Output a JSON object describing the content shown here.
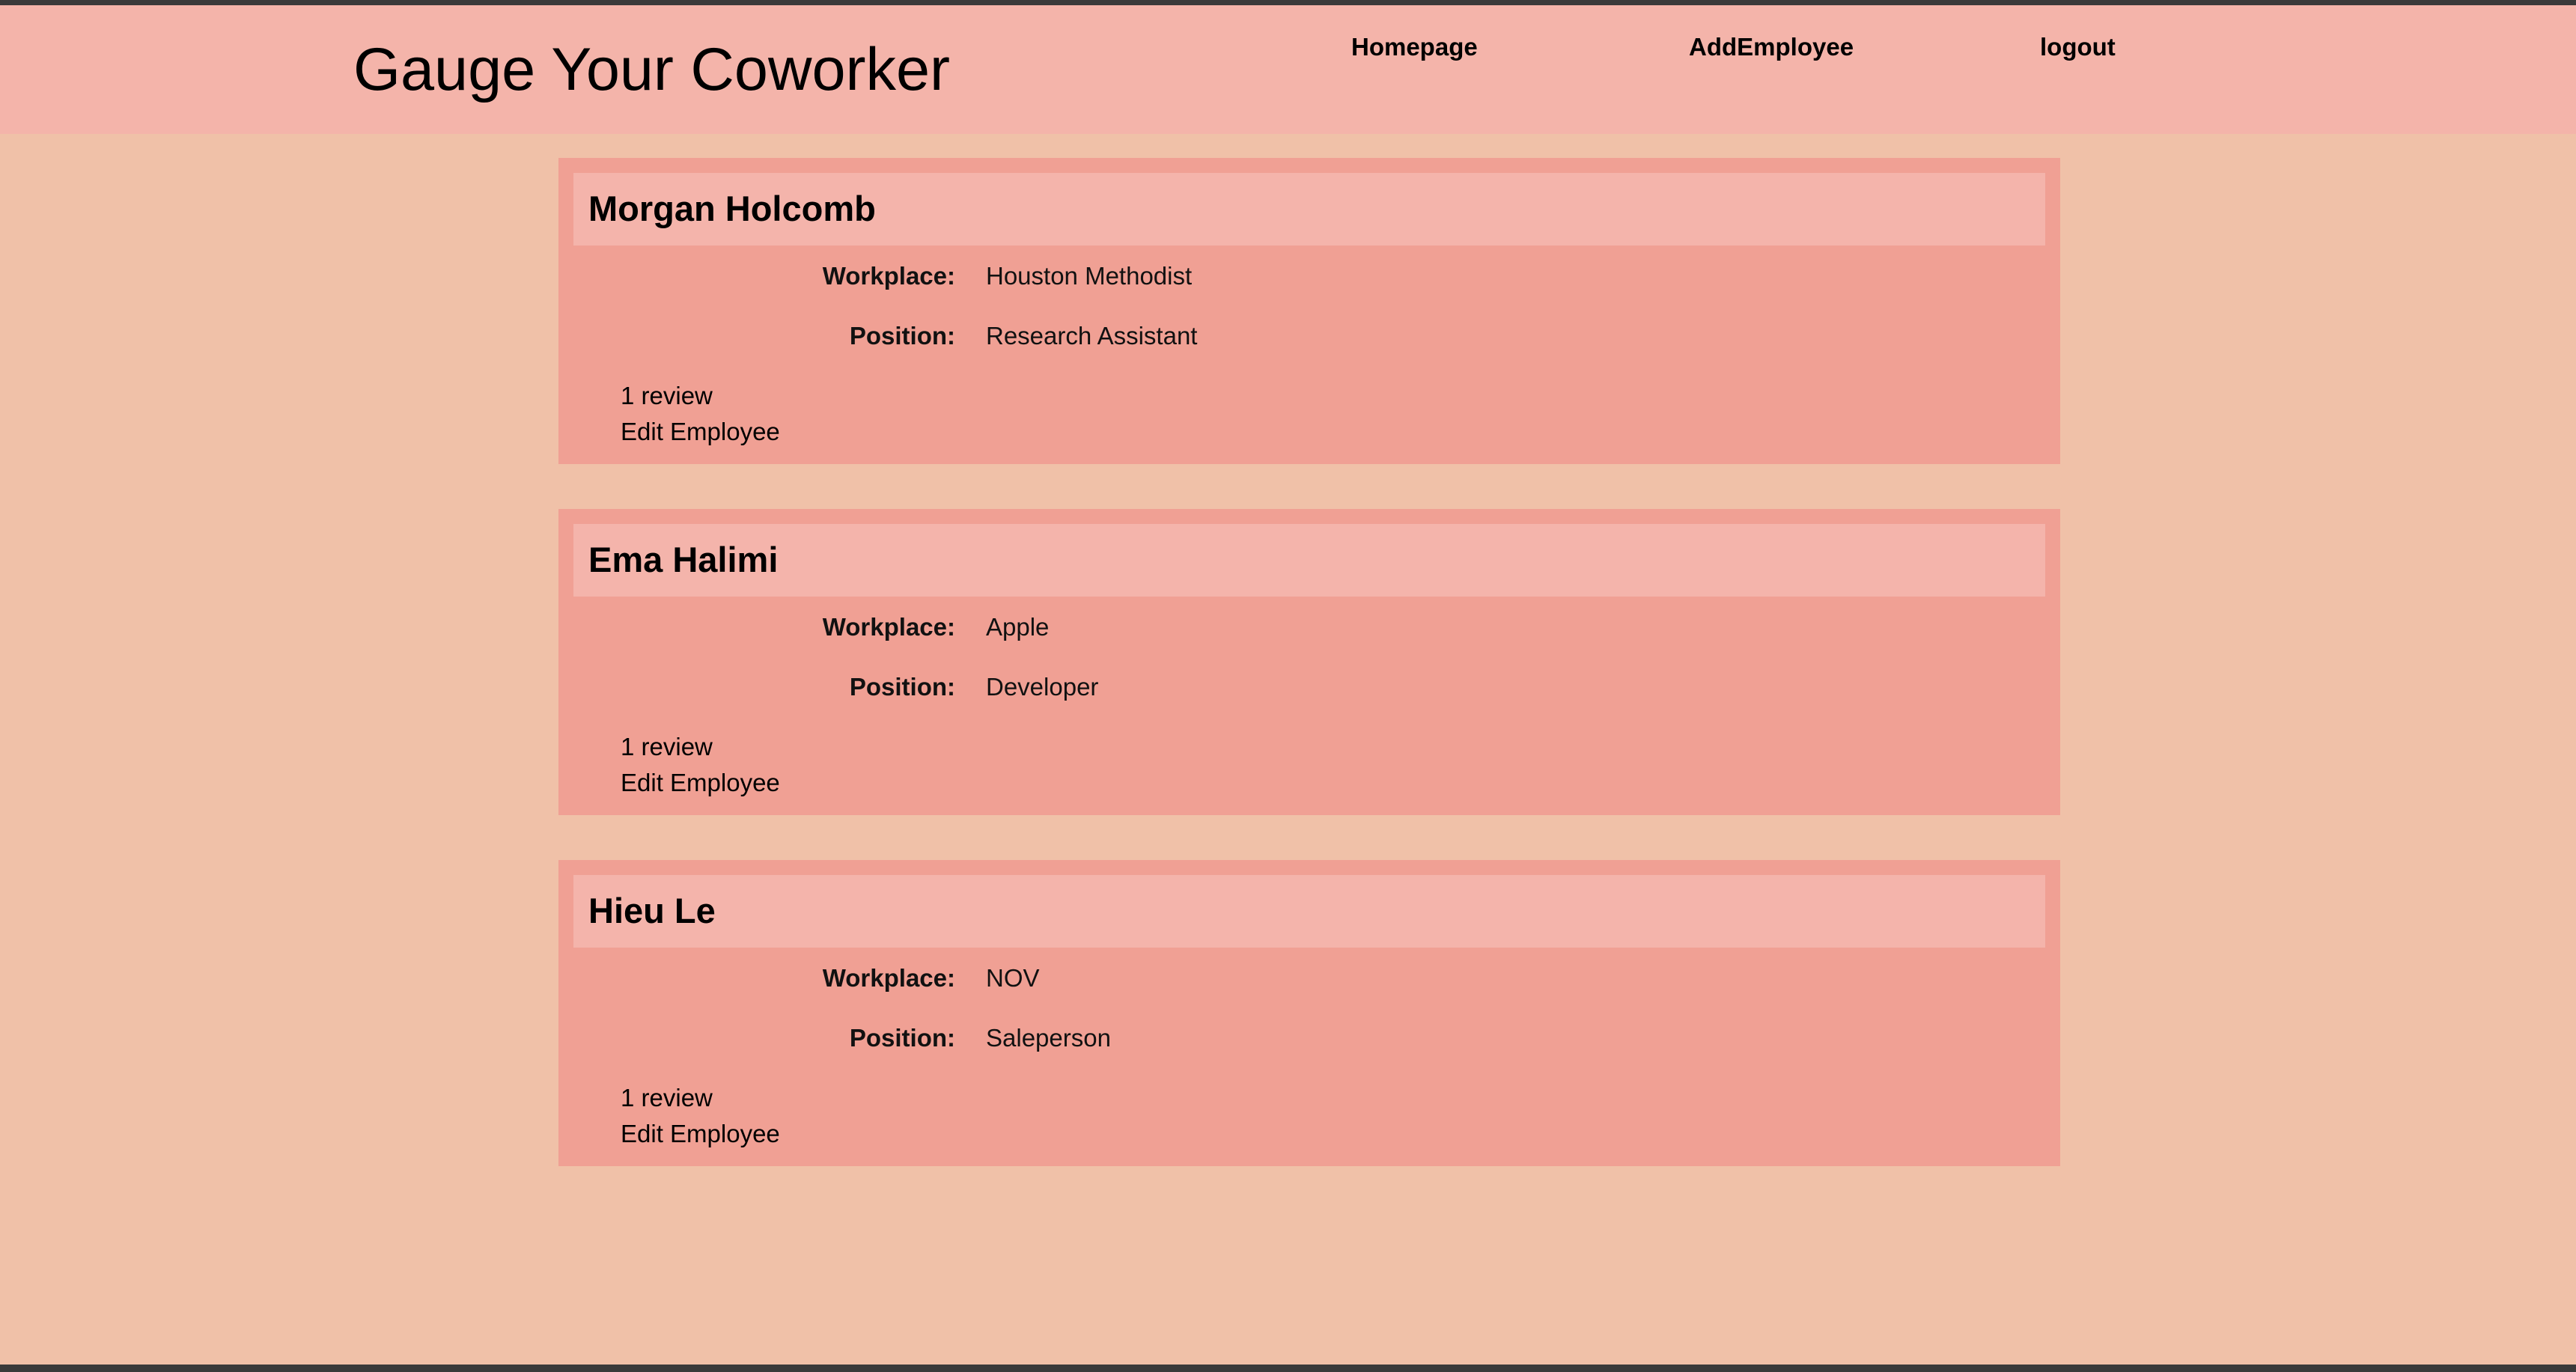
{
  "header": {
    "title": "Gauge Your Coworker",
    "nav": {
      "homepage": "Homepage",
      "add_employee": "AddEmployee",
      "logout": "logout"
    }
  },
  "labels": {
    "workplace": "Workplace:",
    "position": "Position:",
    "edit": "Edit Employee"
  },
  "employees": [
    {
      "name": "Morgan Holcomb",
      "workplace": "Houston Methodist",
      "position": "Research Assistant",
      "reviews": "1 review"
    },
    {
      "name": "Ema Halimi",
      "workplace": "Apple",
      "position": "Developer",
      "reviews": "1 review"
    },
    {
      "name": "Hieu Le",
      "workplace": "NOV",
      "position": "Saleperson",
      "reviews": "1 review"
    }
  ],
  "colors": {
    "page_background": "#f0c1a8",
    "header_background": "#f4b4aa",
    "card_background": "#f0a094",
    "card_header_background": "#f4b4ab"
  }
}
